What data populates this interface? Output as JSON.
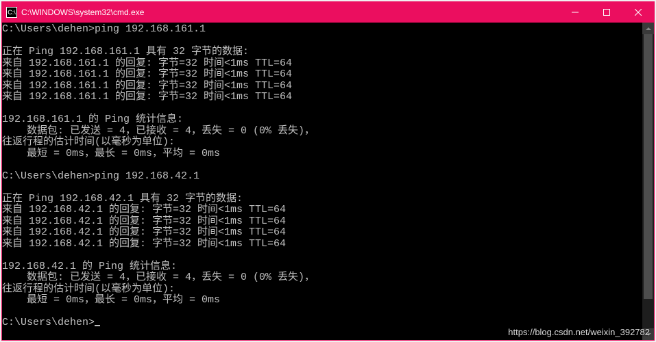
{
  "titlebar": {
    "icon_label": "C:\\",
    "title": "C:\\WINDOWS\\system32\\cmd.exe"
  },
  "terminal": {
    "prompt": "C:\\Users\\dehen>",
    "cmd1": "ping 192.168.161.1",
    "blank": "",
    "ping1_header": "正在 Ping 192.168.161.1 具有 32 字节的数据:",
    "ping1_reply1": "来自 192.168.161.1 的回复: 字节=32 时间<1ms TTL=64",
    "ping1_reply2": "来自 192.168.161.1 的回复: 字节=32 时间<1ms TTL=64",
    "ping1_reply3": "来自 192.168.161.1 的回复: 字节=32 时间<1ms TTL=64",
    "ping1_reply4": "来自 192.168.161.1 的回复: 字节=32 时间<1ms TTL=64",
    "ping1_stats_header": "192.168.161.1 的 Ping 统计信息:",
    "ping1_stats_packets": "    数据包: 已发送 = 4，已接收 = 4，丢失 = 0 (0% 丢失)，",
    "ping1_rtt_header": "往返行程的估计时间(以毫秒为单位):",
    "ping1_rtt_values": "    最短 = 0ms，最长 = 0ms，平均 = 0ms",
    "cmd2": "ping 192.168.42.1",
    "ping2_header": "正在 Ping 192.168.42.1 具有 32 字节的数据:",
    "ping2_reply1": "来自 192.168.42.1 的回复: 字节=32 时间<1ms TTL=64",
    "ping2_reply2": "来自 192.168.42.1 的回复: 字节=32 时间<1ms TTL=64",
    "ping2_reply3": "来自 192.168.42.1 的回复: 字节=32 时间<1ms TTL=64",
    "ping2_reply4": "来自 192.168.42.1 的回复: 字节=32 时间<1ms TTL=64",
    "ping2_stats_header": "192.168.42.1 的 Ping 统计信息:",
    "ping2_stats_packets": "    数据包: 已发送 = 4，已接收 = 4，丢失 = 0 (0% 丢失)，",
    "ping2_rtt_header": "往返行程的估计时间(以毫秒为单位):",
    "ping2_rtt_values": "    最短 = 0ms，最长 = 0ms，平均 = 0ms"
  },
  "watermark": "https://blog.csdn.net/weixin_392782"
}
